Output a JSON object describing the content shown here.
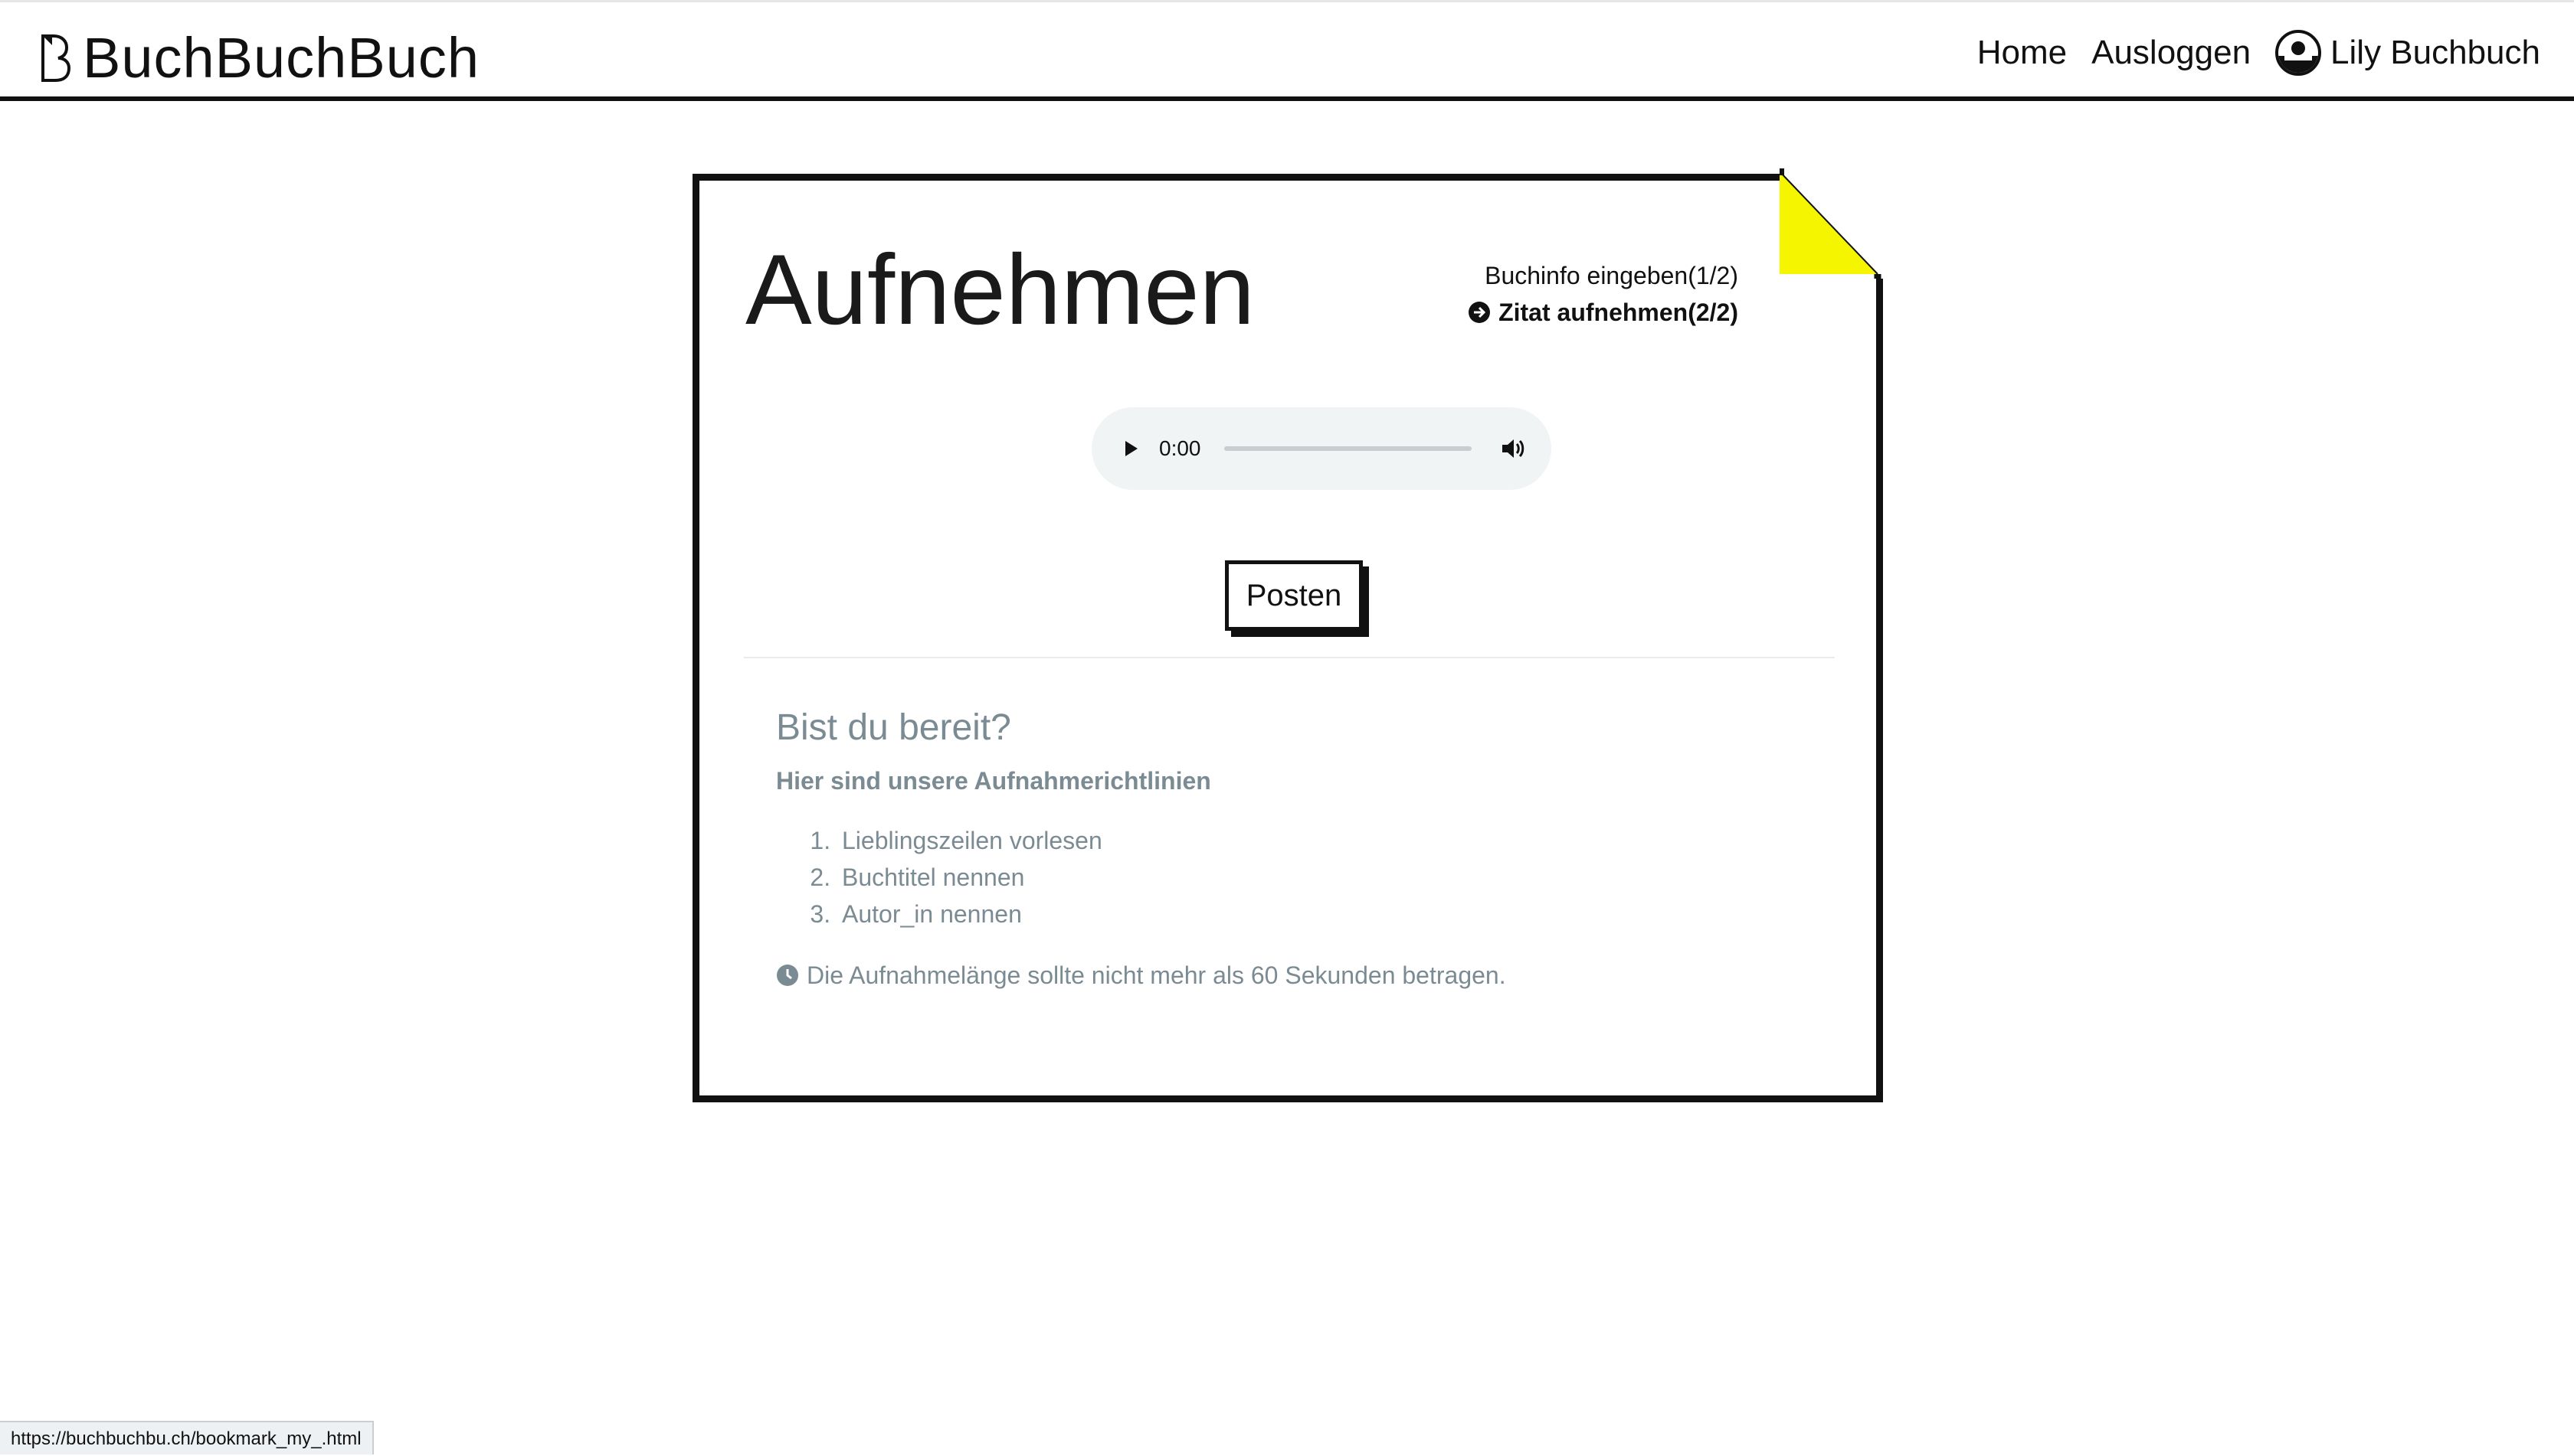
{
  "brand": {
    "name": "BuchBuchBuch"
  },
  "nav": {
    "home": "Home",
    "logout": "Ausloggen",
    "user_name": "Lily Buchbuch"
  },
  "page": {
    "title": "Aufnehmen"
  },
  "steps": [
    {
      "label": "Buchinfo eingeben(1/2)",
      "active": false
    },
    {
      "label": "Zitat aufnehmen(2/2)",
      "active": true
    }
  ],
  "audio": {
    "time": "0:00"
  },
  "post_button": {
    "label": "Posten"
  },
  "info": {
    "title": "Bist du bereit?",
    "subtitle": "Hier sind unsere Aufnahmerichtlinien",
    "items": [
      "Lieblingszeilen vorlesen",
      "Buchtitel nennen",
      "Autor_in nennen"
    ],
    "note": "Die Aufnahmelänge sollte nicht mehr als 60 Sekunden betragen."
  },
  "status_bar": {
    "url": "https://buchbuchbu.ch/bookmark_my_.html"
  },
  "colors": {
    "accent_fold": "#f5f500",
    "muted_text": "#7b8b93",
    "border": "#111111"
  }
}
